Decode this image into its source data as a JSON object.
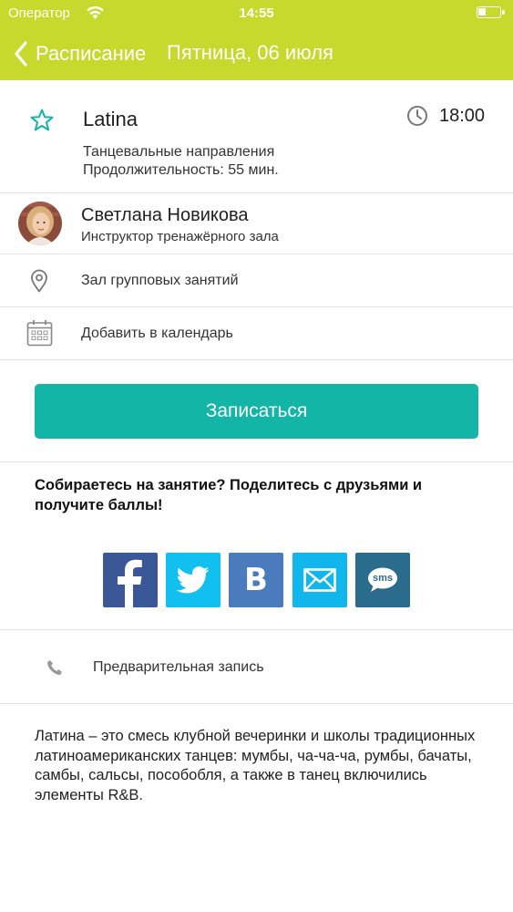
{
  "status_bar": {
    "carrier": "Оператор",
    "time": "14:55"
  },
  "nav": {
    "back_label": "Расписание",
    "title": "Пятница, 06 июля"
  },
  "class_info": {
    "title": "Latina",
    "time": "18:00",
    "category": "Танцевальные направления",
    "duration": "Продолжительность: 55 мин."
  },
  "trainer": {
    "name": "Светлана Новикова",
    "role": "Инструктор тренажёрного зала"
  },
  "location": {
    "label": "Зал групповых занятий"
  },
  "calendar": {
    "label": "Добавить в календарь"
  },
  "signup": {
    "label": "Записаться"
  },
  "share": {
    "prompt": "Собираетесь на занятие? Поделитесь с друзьями и получите баллы!",
    "buttons": [
      {
        "name": "facebook",
        "glyph": "f",
        "color": "#3a5897"
      },
      {
        "name": "twitter",
        "color": "#12c0ef"
      },
      {
        "name": "vk",
        "glyph": "В",
        "color": "#4a7bbd"
      },
      {
        "name": "email",
        "color": "#11b6ec"
      },
      {
        "name": "sms",
        "glyph": "sms",
        "color": "#2b6c8c"
      }
    ]
  },
  "booking": {
    "label": "Предварительная запись"
  },
  "description": {
    "text": "Латина – это смесь клубной вечеринки и школы традиционных латиноамериканских танцев: мумбы, ча-ча-ча, румбы, бачаты, самбы, сальсы, пособобля, а также в танец включились элементы R&B."
  },
  "colors": {
    "header": "#c6d92c",
    "accent": "#12b5a6"
  }
}
